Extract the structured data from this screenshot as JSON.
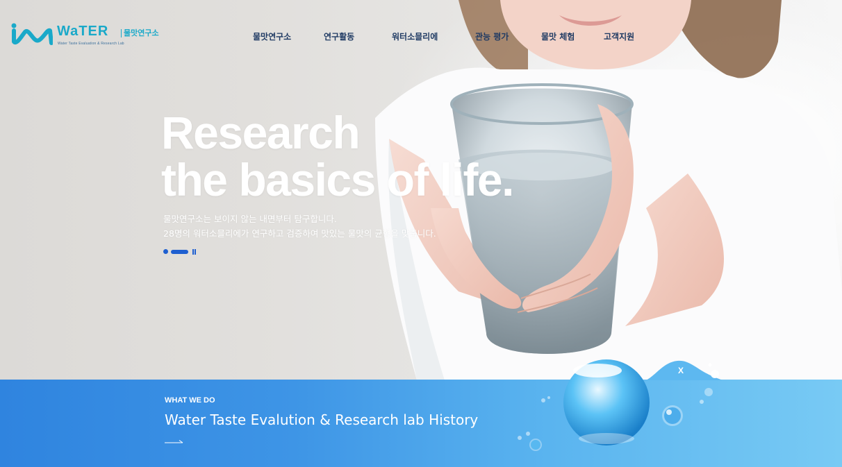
{
  "header": {
    "logo": {
      "wordmark": "WaTER",
      "korean_name": "물맛연구소",
      "tagline": "Water Taste Evaluation & Research Lab",
      "brand_color": "#1aa9c9"
    },
    "nav": [
      {
        "label": "물맛연구소"
      },
      {
        "label": "연구활동"
      },
      {
        "label": "워터소믈리에"
      },
      {
        "label": "관능 평가"
      },
      {
        "label": "물맛 체험"
      },
      {
        "label": "고객지원"
      }
    ]
  },
  "hero": {
    "headline_line1": "Research",
    "headline_line2": "the basics of life.",
    "sub_line1": "물맛연구소는 보이지 않는 내면부터 탐구합니다.",
    "sub_line2": "28명의 워터소믈리에가 연구하고 검증하여 맛있는 물맛의 균형을 맞춥니다.",
    "slider": {
      "pause_icon": "pause-icon",
      "accent": "#1e5fd0"
    }
  },
  "band": {
    "eyebrow": "WHAT WE DO",
    "title": "Water Taste Evalution & Research lab History",
    "arrow_icon": "long-arrow-right-icon",
    "close_label": "X"
  },
  "colors": {
    "nav_text": "#1f3a63",
    "band_start": "#2f84df",
    "band_end": "#78caf4"
  }
}
